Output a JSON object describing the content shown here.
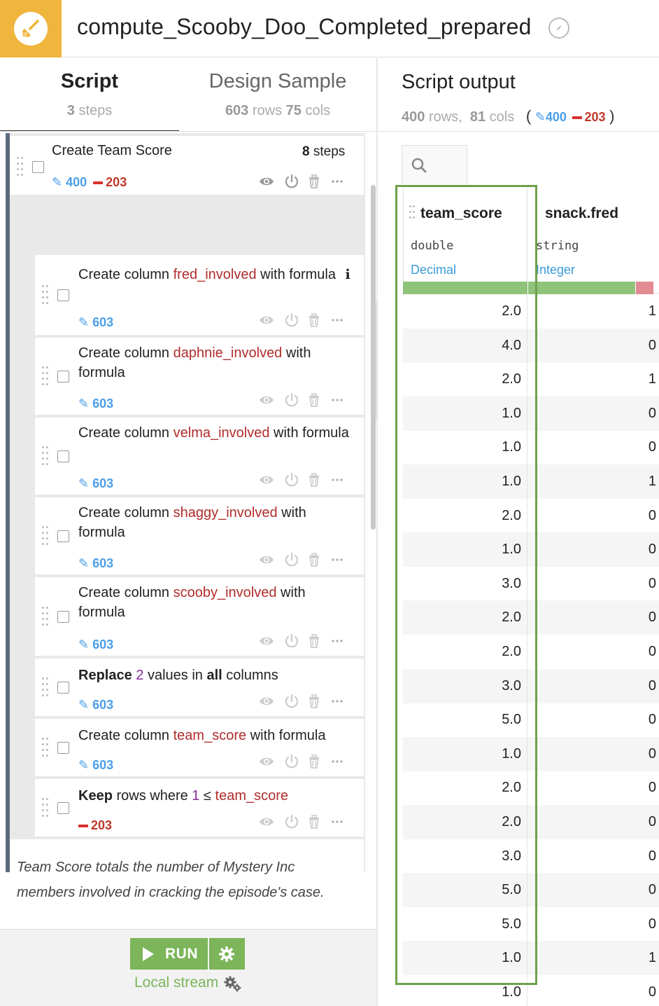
{
  "header": {
    "title": "compute_Scooby_Doo_Completed_prepared",
    "logo_icon": "brush-icon",
    "logo_color": "#f0b53d"
  },
  "tabs": {
    "script": {
      "label": "Script",
      "count": "3",
      "unit": "steps"
    },
    "design": {
      "label": "Design Sample",
      "rows": "603",
      "rows_unit": "rows",
      "cols": "75",
      "cols_unit": "cols"
    }
  },
  "search": {
    "placeholder": "Search steps..."
  },
  "group": {
    "title": "Create Team Score",
    "steps_count": "8",
    "steps_unit": "steps",
    "modified": "400",
    "removed": "203"
  },
  "steps": [
    {
      "prefix": "Create column ",
      "column": "fred_involved",
      "suffix": " with formula",
      "info": "i",
      "modified": "603"
    },
    {
      "prefix": "Create column ",
      "column": "daphnie_involved",
      "suffix": " with formula",
      "modified": "603"
    },
    {
      "prefix": "Create column ",
      "column": "velma_involved",
      "suffix": " with formula",
      "modified": "603"
    },
    {
      "prefix": "Create column ",
      "column": "shaggy_involved",
      "suffix": " with formula",
      "modified": "603"
    },
    {
      "prefix": "Create column ",
      "column": "scooby_involved",
      "suffix": " with formula",
      "modified": "603"
    },
    {
      "bold1": "Replace",
      "num": "2",
      "mid": "values in",
      "bold2": "all",
      "end": "columns",
      "modified": "603"
    },
    {
      "prefix": "Create column ",
      "column": "team_score",
      "suffix": " with formula",
      "modified": "603"
    },
    {
      "bold1": "Keep",
      "mid": "rows where",
      "num": "1",
      "op": "≤",
      "column": "team_score",
      "removed": "203"
    }
  ],
  "note": "Team Score totals the number of Mystery Inc members involved in cracking the episode's case.",
  "run": {
    "label": "RUN",
    "engine": "Local stream"
  },
  "output": {
    "title": "Script output",
    "rows": "400",
    "rows_unit": "rows,",
    "cols": "81",
    "cols_unit": "cols",
    "modified": "400",
    "removed": "203"
  },
  "columns": [
    {
      "name": "team_score",
      "type": "double",
      "meaning": "Decimal"
    },
    {
      "name": "snack.fred",
      "type": "string",
      "meaning": "Integer"
    }
  ],
  "rows": [
    [
      "2.0",
      "1"
    ],
    [
      "4.0",
      "0"
    ],
    [
      "2.0",
      "1"
    ],
    [
      "1.0",
      "0"
    ],
    [
      "1.0",
      "0"
    ],
    [
      "1.0",
      "1"
    ],
    [
      "2.0",
      "0"
    ],
    [
      "1.0",
      "0"
    ],
    [
      "3.0",
      "0"
    ],
    [
      "2.0",
      "0"
    ],
    [
      "2.0",
      "0"
    ],
    [
      "3.0",
      "0"
    ],
    [
      "5.0",
      "0"
    ],
    [
      "1.0",
      "0"
    ],
    [
      "2.0",
      "0"
    ],
    [
      "2.0",
      "0"
    ],
    [
      "3.0",
      "0"
    ],
    [
      "5.0",
      "0"
    ],
    [
      "5.0",
      "0"
    ],
    [
      "1.0",
      "1"
    ],
    [
      "1.0",
      "0"
    ]
  ],
  "colors": {
    "accent_green": "#7cb55a",
    "modified_blue": "#4a9ee8",
    "removed_red": "#c0392b",
    "column_red": "#b22c2c"
  }
}
